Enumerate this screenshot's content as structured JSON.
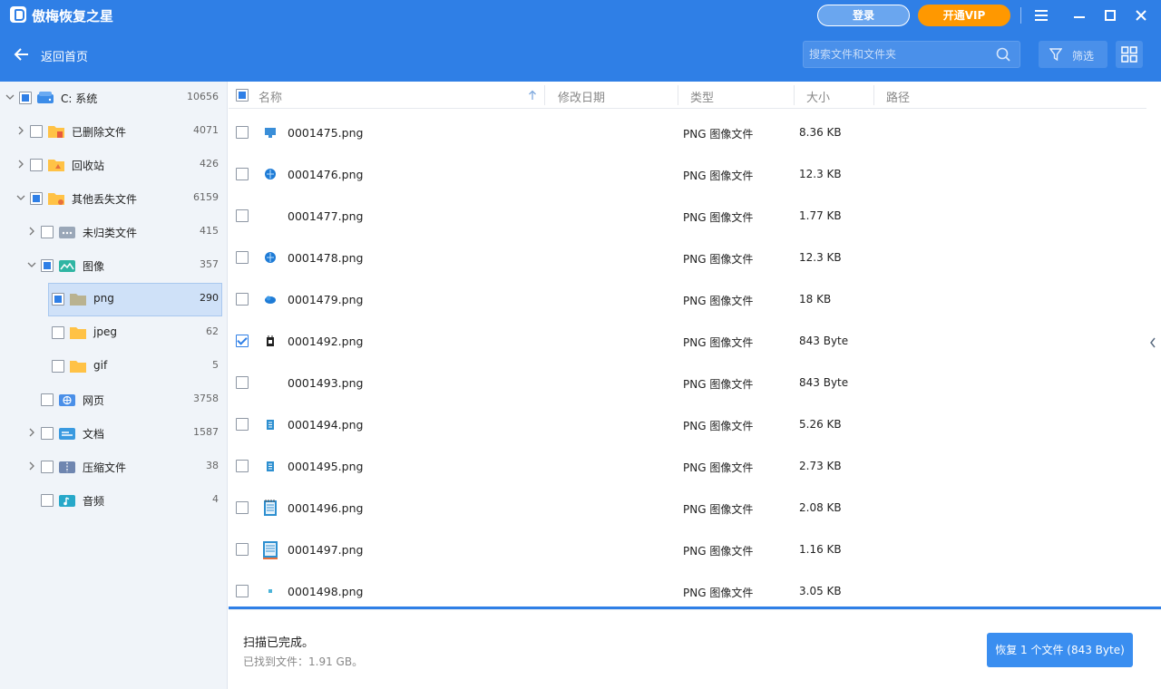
{
  "app": {
    "title": "傲梅恢复之星",
    "login_label": "登录",
    "vip_label": "开通VIP"
  },
  "toolbar": {
    "back_label": "返回首页",
    "search_placeholder": "搜索文件和文件夹",
    "filter_label": "筛选"
  },
  "sidebar": {
    "items": [
      {
        "label": "C: 系统",
        "count": "10656"
      },
      {
        "label": "已删除文件",
        "count": "4071"
      },
      {
        "label": "回收站",
        "count": "426"
      },
      {
        "label": "其他丢失文件",
        "count": "6159"
      },
      {
        "label": "未归类文件",
        "count": "415"
      },
      {
        "label": "图像",
        "count": "357"
      },
      {
        "label": "png",
        "count": "290"
      },
      {
        "label": "jpeg",
        "count": "62"
      },
      {
        "label": "gif",
        "count": "5"
      },
      {
        "label": "网页",
        "count": "3758"
      },
      {
        "label": "文档",
        "count": "1587"
      },
      {
        "label": "压缩文件",
        "count": "38"
      },
      {
        "label": "音频",
        "count": "4"
      }
    ]
  },
  "columns": {
    "name": "名称",
    "modified": "修改日期",
    "type": "类型",
    "size": "大小",
    "path": "路径"
  },
  "files": [
    {
      "name": "0001475.png",
      "type": "PNG 图像文件",
      "size": "8.36 KB",
      "checked": false,
      "icon": "monitor-icon"
    },
    {
      "name": "0001476.png",
      "type": "PNG 图像文件",
      "size": "12.3 KB",
      "checked": false,
      "icon": "globe-icon"
    },
    {
      "name": "0001477.png",
      "type": "PNG 图像文件",
      "size": "1.77 KB",
      "checked": false,
      "icon": "none"
    },
    {
      "name": "0001478.png",
      "type": "PNG 图像文件",
      "size": "12.3 KB",
      "checked": false,
      "icon": "globe-icon"
    },
    {
      "name": "0001479.png",
      "type": "PNG 图像文件",
      "size": "18 KB",
      "checked": false,
      "icon": "cloud-icon"
    },
    {
      "name": "0001492.png",
      "type": "PNG 图像文件",
      "size": "843 Byte",
      "checked": true,
      "icon": "chip-icon"
    },
    {
      "name": "0001493.png",
      "type": "PNG 图像文件",
      "size": "843 Byte",
      "checked": false,
      "icon": "none"
    },
    {
      "name": "0001494.png",
      "type": "PNG 图像文件",
      "size": "5.26 KB",
      "checked": false,
      "icon": "notepad-icon"
    },
    {
      "name": "0001495.png",
      "type": "PNG 图像文件",
      "size": "2.73 KB",
      "checked": false,
      "icon": "notepad-icon"
    },
    {
      "name": "0001496.png",
      "type": "PNG 图像文件",
      "size": "2.08 KB",
      "checked": false,
      "icon": "notepad-large-icon"
    },
    {
      "name": "0001497.png",
      "type": "PNG 图像文件",
      "size": "1.16 KB",
      "checked": false,
      "icon": "notepad-large-icon"
    },
    {
      "name": "0001498.png",
      "type": "PNG 图像文件",
      "size": "3.05 KB",
      "checked": false,
      "icon": "dot-icon"
    }
  ],
  "footer": {
    "status": "扫描已完成。",
    "found": "已找到文件：1.91 GB。",
    "recover_label": "恢复 1 个文件 (843 Byte)"
  },
  "colors": {
    "accent": "#2f7fe6",
    "vip": "#ff9800",
    "sidebar_bg": "#f0f4f9",
    "selected_bg": "#cfe1f8"
  }
}
